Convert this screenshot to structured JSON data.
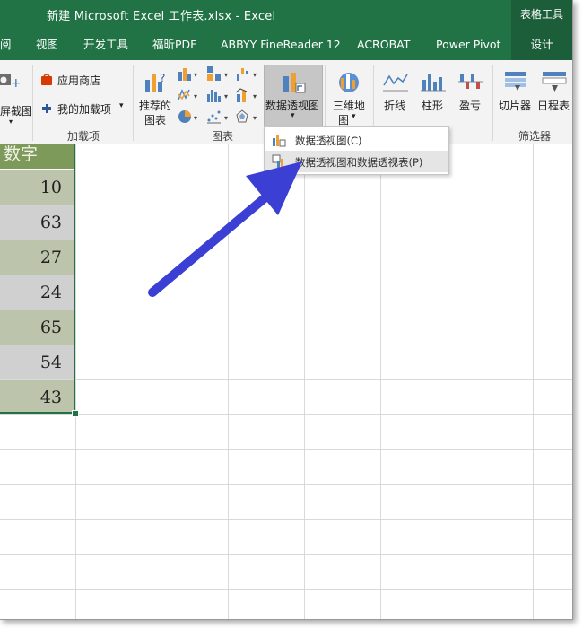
{
  "titlebar": {
    "title": "新建 Microsoft Excel 工作表.xlsx  -  Excel",
    "context_tab": "表格工具"
  },
  "tabs": {
    "review_partial": "阅",
    "view": "视图",
    "developer": "开发工具",
    "foxit": "福昕PDF",
    "abbyy": "ABBYY FineReader 12",
    "acrobat": "ACROBAT",
    "power_pivot": "Power Pivot",
    "design": "设计"
  },
  "ribbon": {
    "screenshot_partial": "屏截图",
    "addins": {
      "store": "应用商店",
      "my_addins": "我的加载项",
      "group_label": "加载项"
    },
    "charts": {
      "recommended_line1": "推荐的",
      "recommended_line2": "图表",
      "pivot_chart": "数据透视图",
      "group_label": "图表"
    },
    "tours": {
      "map_line1": "三维地",
      "map_line2": "图"
    },
    "sparklines": {
      "line": "折线",
      "column": "柱形",
      "win_loss": "盈亏"
    },
    "filters": {
      "slicer": "切片器",
      "timeline": "日程表",
      "group_label": "筛选器"
    }
  },
  "dropdown": {
    "item1": "数据透视图(C)",
    "item2": "数据透视图和数据透视表(P)"
  },
  "sheet": {
    "header": "数字",
    "values": [
      "10",
      "63",
      "27",
      "24",
      "65",
      "54",
      "43"
    ]
  },
  "colors": {
    "excel_green": "#217346",
    "arrow": "#3b3fd4",
    "header_fill": "#7e9a5a"
  }
}
